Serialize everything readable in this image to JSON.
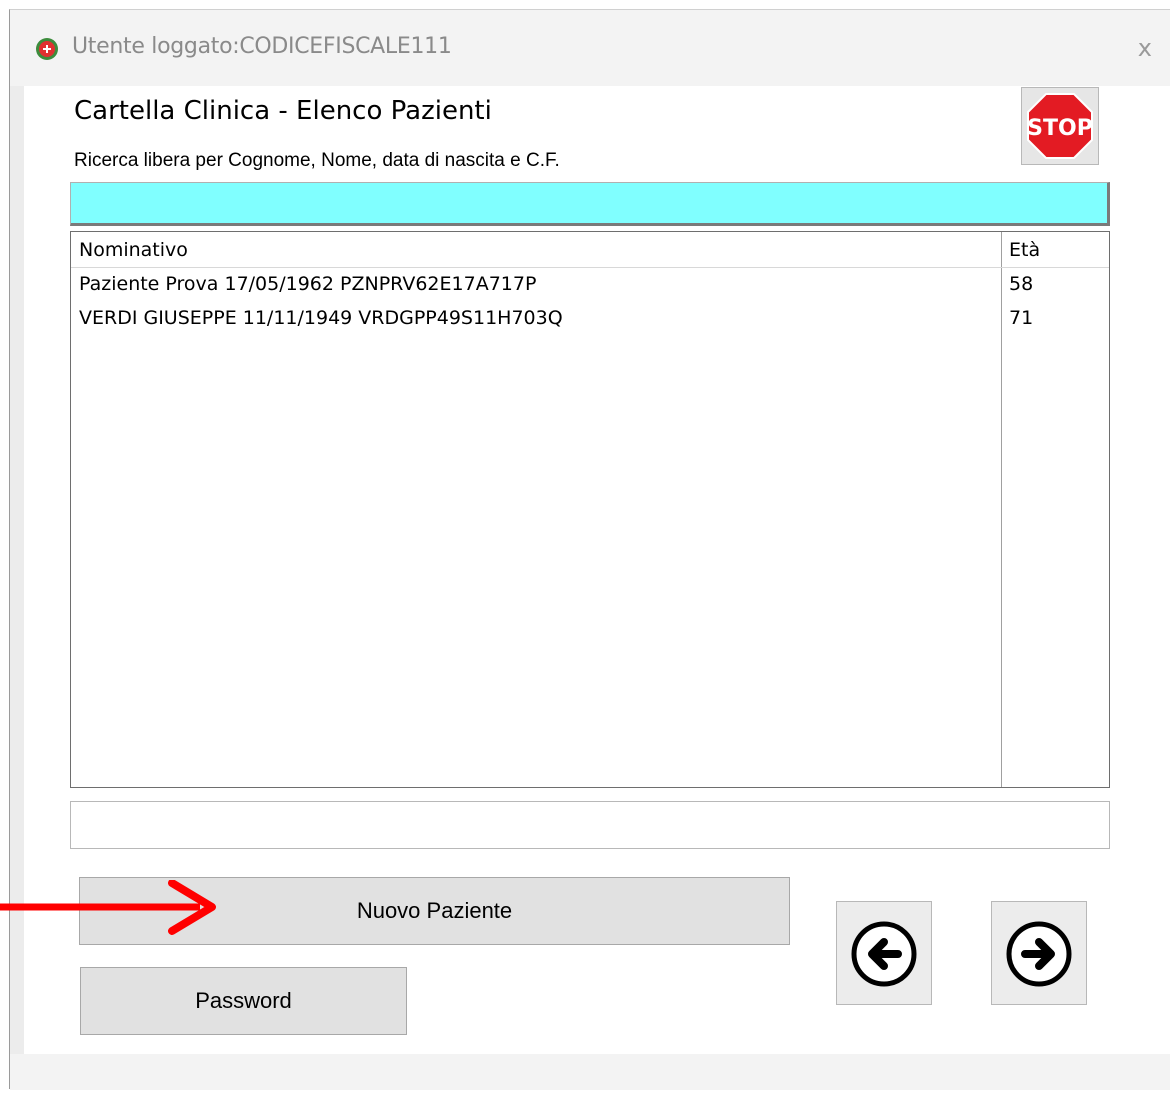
{
  "window": {
    "title": "Utente loggato:CODICEFISCALE111",
    "close_label": "x"
  },
  "header": {
    "title": "Cartella Clinica - Elenco Pazienti",
    "search_hint": "Ricerca libera per Cognome, Nome, data di nascita e C.F.",
    "stop_label": "STOP"
  },
  "search": {
    "value": ""
  },
  "list": {
    "columns": [
      "Nominativo",
      "Età"
    ],
    "rows": [
      {
        "nominativo": "Paziente Prova 17/05/1962 PZNPRV62E17A717P",
        "eta": "58"
      },
      {
        "nominativo": "VERDI GIUSEPPE 11/11/1949 VRDGPP49S11H703Q",
        "eta": "71"
      }
    ]
  },
  "status": {
    "value": ""
  },
  "buttons": {
    "new_patient": "Nuovo Paziente",
    "password": "Password",
    "prev_icon": "arrow-left-icon",
    "next_icon": "arrow-right-icon"
  },
  "colors": {
    "search_bg": "#80ffff",
    "stop_red": "#e31b23",
    "annotation_arrow": "#ff0000"
  }
}
